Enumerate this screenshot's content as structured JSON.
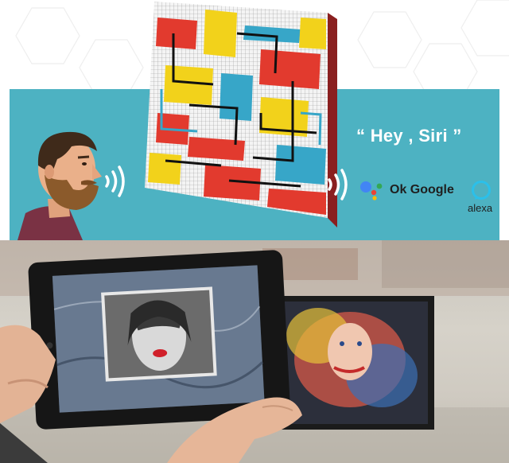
{
  "voice": {
    "siri_phrase": "“ Hey , Siri ”",
    "google_label": "Ok Google",
    "alexa_label": "alexa"
  },
  "colors": {
    "banner": "#4db2c2",
    "google_blue": "#4285f4",
    "google_red": "#ea4335",
    "google_yellow": "#fbbc05",
    "google_green": "#34a853",
    "alexa_ring": "#2bc0ea"
  },
  "icons": [
    "sound-waves-icon",
    "google-assistant-icon",
    "alexa-ring-icon"
  ]
}
